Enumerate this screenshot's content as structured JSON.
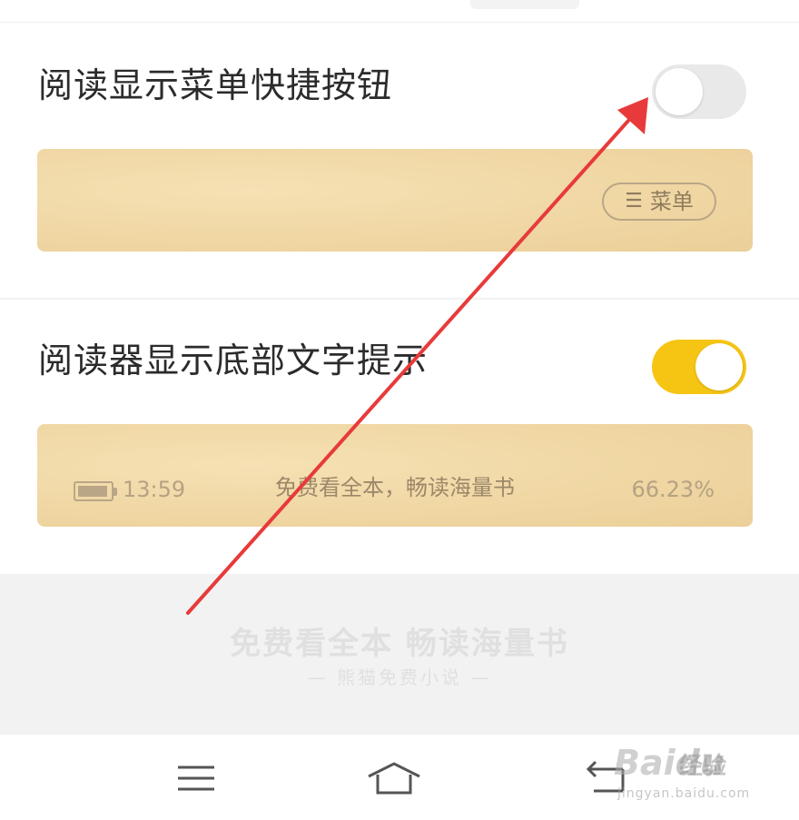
{
  "settings": [
    {
      "label": "阅读显示菜单快捷按钮",
      "enabled": false
    },
    {
      "label": "阅读器显示底部文字提示",
      "enabled": true
    }
  ],
  "menu_preview": {
    "icon": "hamburger-icon",
    "label": "菜单"
  },
  "footer_preview": {
    "time": "13:59",
    "slogan": "免费看全本，畅读海量书",
    "progress": "66.23%"
  },
  "promo": {
    "title": "免费看全本 畅读海量书",
    "subtitle": "— 熊猫免费小说 —"
  },
  "navbar": [
    "menu-icon",
    "home-icon",
    "back-icon"
  ],
  "watermark": {
    "brand": "Bai",
    "brand_du": "du",
    "suffix": "经验",
    "url": "jingyan.baidu.com"
  },
  "colors": {
    "toggle_on": "#f6c514",
    "toggle_off": "#e9e9e9",
    "annotation_arrow": "#e83a3a",
    "paper": "#f0d7a4"
  }
}
